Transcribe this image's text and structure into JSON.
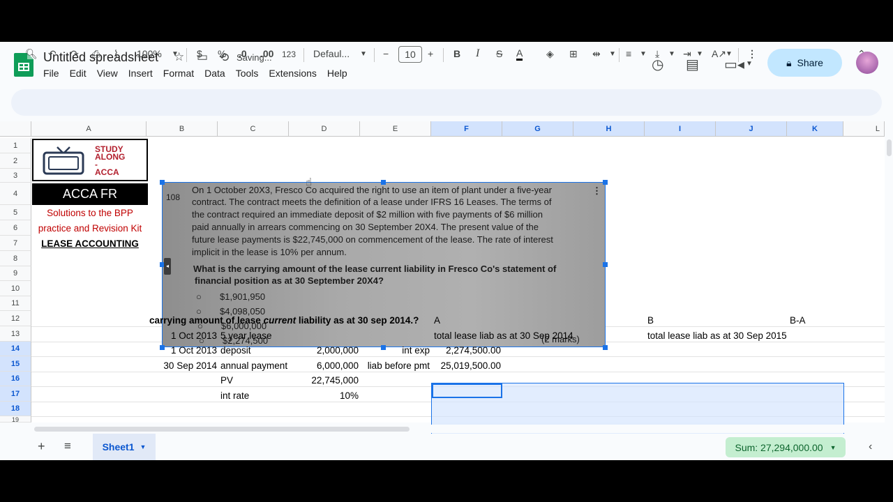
{
  "app": {
    "title": "Untitled spreadsheet",
    "status": "Saving..."
  },
  "menu": [
    "File",
    "Edit",
    "View",
    "Insert",
    "Format",
    "Data",
    "Tools",
    "Extensions",
    "Help"
  ],
  "share_label": "Share",
  "toolbar": {
    "zoom": "100%",
    "currency": "$",
    "percent": "%",
    "dec_decrease": ".0",
    "dec_increase": ".00",
    "number_format": "123",
    "font": "Defaul...",
    "font_size": "10"
  },
  "columns": [
    "A",
    "B",
    "C",
    "D",
    "E",
    "F",
    "G",
    "H",
    "I",
    "J",
    "K",
    "L"
  ],
  "rows": [
    "1",
    "2",
    "3",
    "4",
    "5",
    "6",
    "7",
    "8",
    "9",
    "10",
    "11",
    "12",
    "13",
    "14",
    "15",
    "16",
    "17",
    "18",
    "19"
  ],
  "logo_block": {
    "study": "STUDY",
    "along": "ALONG",
    "dash": "-",
    "acca": "ACCA",
    "banner": "ACCA FR",
    "solutions1": "Solutions to the BPP",
    "solutions2": "practice and Revision Kit",
    "topic": "LEASE ACCOUNTING"
  },
  "question": {
    "number": "108",
    "lines": [
      "On 1 October 20X3, Fresco Co acquired the right to use an item of plant under a five-year",
      "contract. The contract meets the definition of a lease under IFRS 16 Leases. The terms of",
      "the contract required an immediate deposit of $2 million with five payments of $6 million",
      "paid annually in arrears commencing on 30 September 20X4. The present value of the",
      "future lease payments is $22,745,000 on commencement of the lease. The rate of interest",
      "implicit in the lease is 10% per annum."
    ],
    "prompt1": "What is the carrying amount of the lease current liability in Fresco Co's statement of",
    "prompt2": "financial position as at 30 September 20X4?",
    "options": [
      "$1,901,950",
      "$4,098,050",
      "$6,000,000",
      "$2,274,500"
    ],
    "marks": "(2 marks)"
  },
  "cells": {
    "heading_pre": "carrying amount of lease ",
    "heading_em": "current",
    "heading_post": " liability as at 30 sep 2014.?",
    "col_a_label": "A",
    "col_b_label": "B",
    "col_ba_label": "B-A",
    "r13_date": "1 Oct 2013",
    "r13_desc": "5 year lease",
    "r13_f": "total lease liab as at 30 Sep 2014",
    "r13_i": "total lease liab as at 30 Sep 2015",
    "r14_date": "1 Oct 2013",
    "r14_desc": "deposit",
    "r14_val": "2,000,000",
    "r14_label": "int exp",
    "r14_f": "2,274,500.00",
    "r15_date": "30 Sep 2014",
    "r15_desc": "annual payment",
    "r15_val": "6,000,000",
    "r15_label": "liab before pmt",
    "r15_f": "25,019,500.00",
    "r16_desc": "PV",
    "r16_val": "22,745,000",
    "r17_desc": "int rate",
    "r17_val": "10%"
  },
  "sheet_tab": "Sheet1",
  "sum_label": "Sum: 27,294,000.00"
}
